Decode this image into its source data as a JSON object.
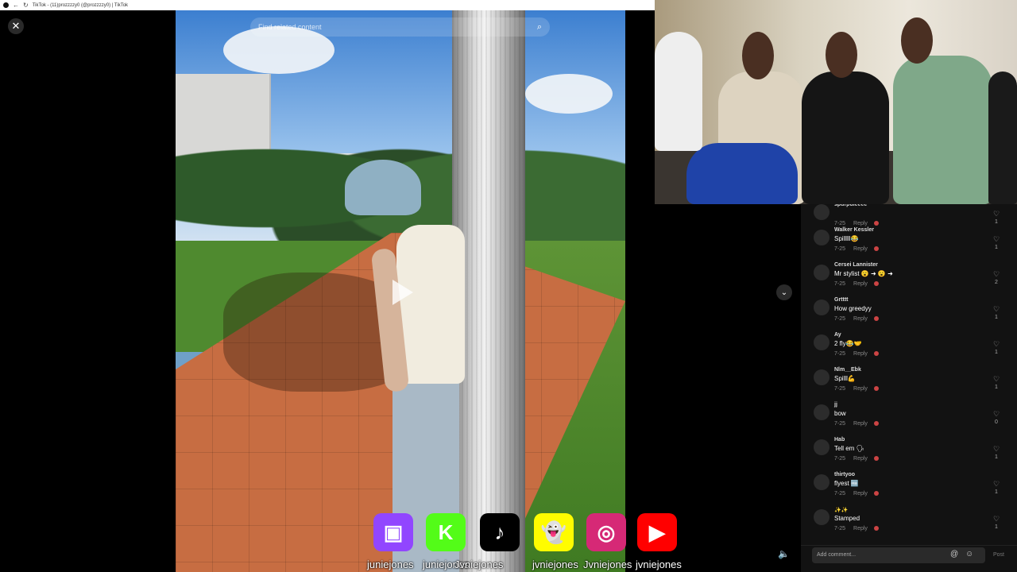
{
  "window": {
    "title": "TikTok - (11)prozzzzy0 (@prozzzzy0) | TikTok"
  },
  "player": {
    "search_placeholder": "Find related content"
  },
  "icons": {
    "close": "close-icon",
    "search": "search-icon",
    "play": "play-icon",
    "scroll_down": "chevron-down-icon",
    "volume": "volume-icon",
    "like": "heart-icon",
    "mention": "at-icon",
    "emoji": "emoji-icon"
  },
  "comments": [
    {
      "name": "spurpuleeee",
      "text": "",
      "date": "7-25",
      "reply": "Reply",
      "likes": "1"
    },
    {
      "name": "Walker Kessler",
      "text": "Spilllll😂",
      "date": "7-25",
      "reply": "Reply",
      "likes": "1"
    },
    {
      "name": "Cersei Lannister",
      "text": "Mr stylist 😮 ➜ 😮 ➜",
      "date": "7-25",
      "reply": "Reply",
      "likes": "2"
    },
    {
      "name": "Grtttt",
      "text": "How greedyy",
      "date": "7-25",
      "reply": "Reply",
      "likes": "1"
    },
    {
      "name": "Ay",
      "text": "2 fly😂🤝",
      "date": "7-25",
      "reply": "Reply",
      "likes": "1"
    },
    {
      "name": "Nlm__Ebk",
      "text": "Spilll💪",
      "date": "7-25",
      "reply": "Reply",
      "likes": "1"
    },
    {
      "name": "jj",
      "text": "bow",
      "date": "7-25",
      "reply": "Reply",
      "likes": "0"
    },
    {
      "name": "Hab",
      "text": "Tell em 🗣",
      "date": "7-25",
      "reply": "Reply",
      "likes": "1"
    },
    {
      "name": "thirtyoo",
      "text": "flyest 🆓",
      "date": "7-25",
      "reply": "Reply",
      "likes": "1"
    },
    {
      "name": "✨✨",
      "text": "Stamped",
      "date": "7-25",
      "reply": "Reply",
      "likes": "1"
    }
  ],
  "comment_bar": {
    "placeholder": "Add comment...",
    "post": "Post"
  },
  "socials": [
    {
      "platform": "Twitch",
      "glyph": "▣",
      "handle": "juniejones",
      "color": "#9146ff"
    },
    {
      "platform": "Kick",
      "glyph": "K",
      "handle": "juniejones",
      "color": "#53fc18"
    },
    {
      "platform": "TikTok",
      "glyph": "♪",
      "handle": "Jvniejones",
      "color": "#000000"
    },
    {
      "platform": "Snapchat",
      "glyph": "👻",
      "handle": "jvniejones",
      "color": "#fffc00"
    },
    {
      "platform": "Instagram",
      "glyph": "◎",
      "handle": "Jvniejones",
      "color": "#d62976"
    },
    {
      "platform": "YouTube",
      "glyph": "▶",
      "handle": "jvniejones",
      "color": "#ff0000"
    }
  ]
}
